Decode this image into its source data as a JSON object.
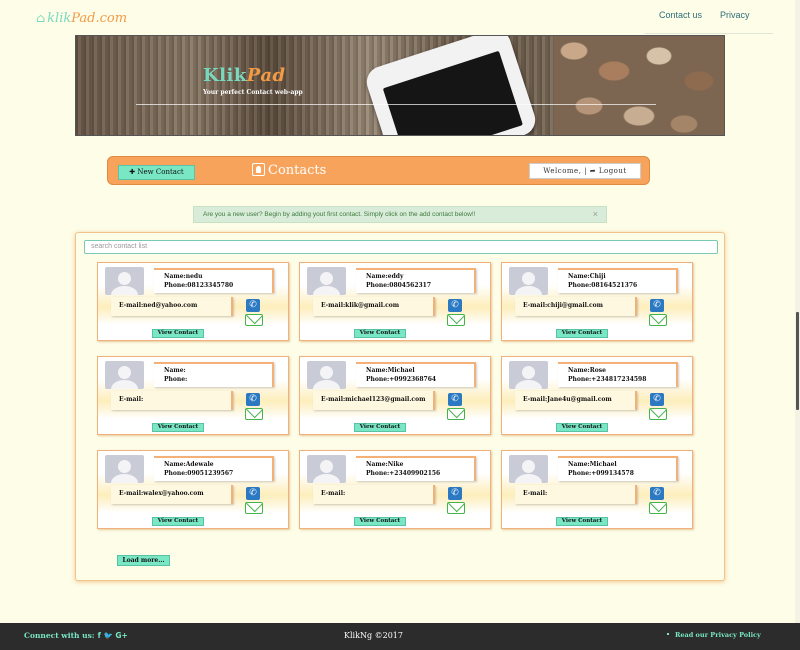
{
  "nav": {
    "brand_a": "klik",
    "brand_b": "Pad.com",
    "contact_us": "Contact us",
    "privacy": "Privacy"
  },
  "hero": {
    "title_a": "Klik",
    "title_b": "Pad",
    "tagline": "Your perfect Contact web-app"
  },
  "bar": {
    "new_contact": "New Contact",
    "title": "Contacts",
    "welcome": "Welcome, | ➦ Logout"
  },
  "alert": {
    "text": "Are you a new user? Begin by adding yout first contact. Simply click on the add contact below!!",
    "close": "×"
  },
  "search": {
    "placeholder": "search contact list"
  },
  "contacts": [
    {
      "name": "Name:nedu",
      "phone": "Phone:08123345780",
      "email": "E-mail:ned@yahoo.com",
      "view": "View Contact"
    },
    {
      "name": "Name:eddy",
      "phone": "Phone:0804562317",
      "email": "E-mail:klik@gmail.com",
      "view": "View Contact"
    },
    {
      "name": "Name:Chiji",
      "phone": "Phone:08164521376",
      "email": "E-mail:chiji@gmail.com",
      "view": "View Contact"
    },
    {
      "name": "Name:",
      "phone": "Phone:",
      "email": "E-mail:",
      "view": "View Contact"
    },
    {
      "name": "Name:Michael",
      "phone": "Phone:+0992368764",
      "email": "E-mail:michael123@gmail.com",
      "view": "View Contact"
    },
    {
      "name": "Name:Rose",
      "phone": "Phone:+234817234598",
      "email": "E-mail:Jane4u@gmail.com",
      "view": "View Contact"
    },
    {
      "name": "Name:Adewale",
      "phone": "Phone:09051239567",
      "email": "E-mail:walex@yahoo.com",
      "view": "View Contact"
    },
    {
      "name": "Name:Nike",
      "phone": "Phone:+23409902156",
      "email": "E-mail:",
      "view": "View Contact"
    },
    {
      "name": "Name:Michael",
      "phone": "Phone:+099134578",
      "email": "E-mail:",
      "view": "View Contact"
    }
  ],
  "load_more": "Load more...",
  "footer": {
    "connect": "Connect with us:",
    "social": "f 🐦 G+",
    "copyright": "KlikNg ©2017",
    "privacy": "Read our Privacy Policy"
  },
  "colors": {
    "accent_mint": "#79e6c4",
    "accent_orange": "#f8a35c",
    "footer_bg": "#2c2c2c"
  }
}
